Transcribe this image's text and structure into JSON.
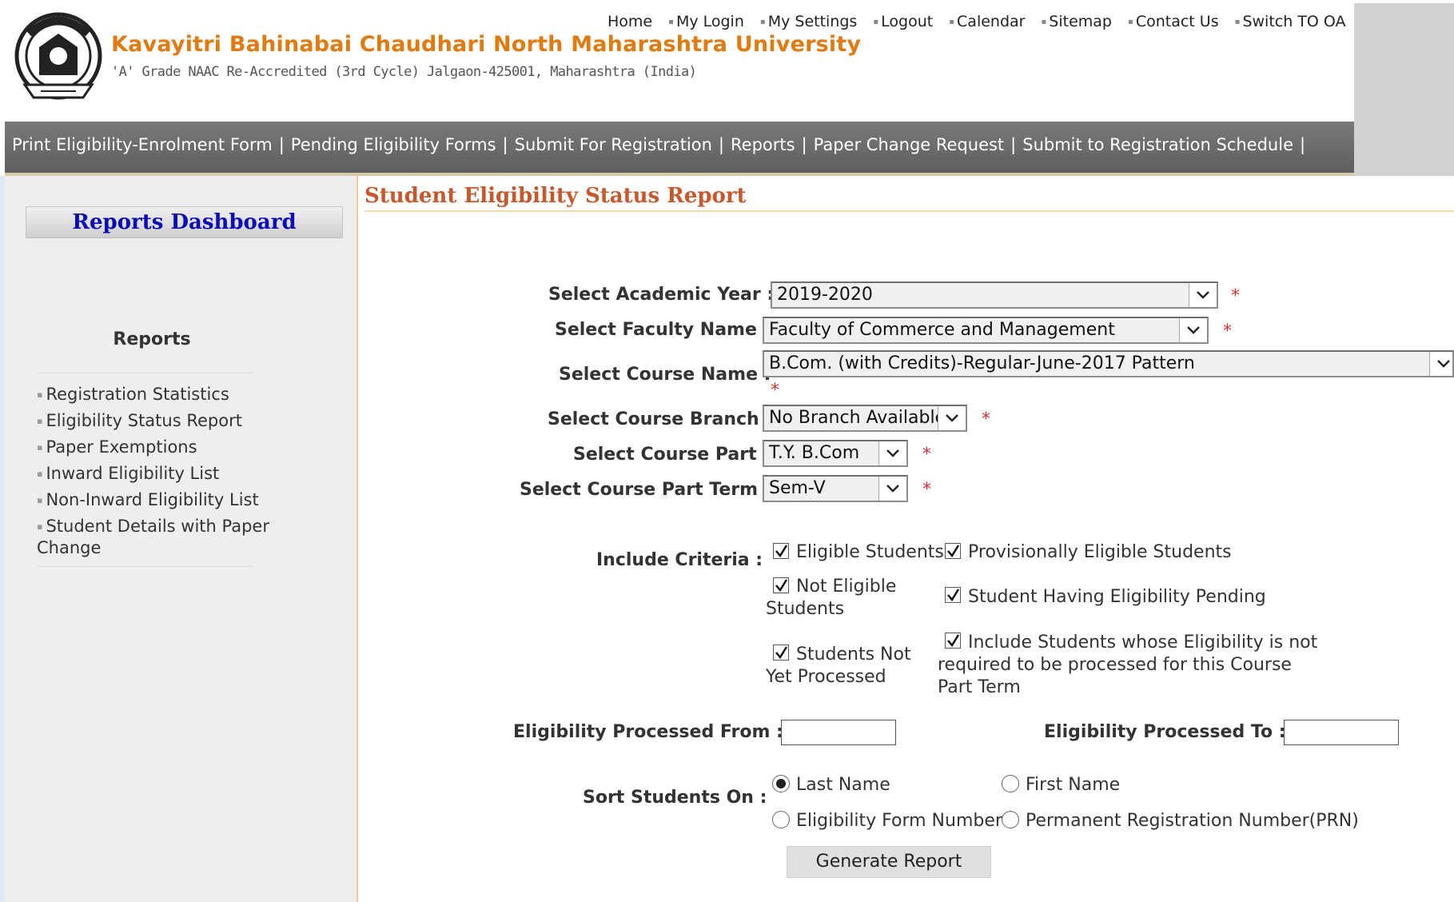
{
  "header": {
    "university_name": "Kavayitri Bahinabai Chaudhari North Maharashtra University",
    "university_sub": "'A' Grade NAAC Re-Accredited (3rd Cycle) Jalgaon-425001, Maharashtra (India)",
    "logo_icon": "university-seal-icon",
    "top_links": [
      "Home",
      "My Login",
      "My Settings",
      "Logout",
      "Calendar",
      "Sitemap",
      "Contact Us",
      "Switch TO OA"
    ]
  },
  "nav": {
    "items": [
      "Print Eligibility-Enrolment Form",
      "Pending Eligibility Forms",
      "Submit For Registration",
      "Reports",
      "Paper Change Request",
      "Submit to Registration Schedule"
    ]
  },
  "sidebar": {
    "title": "Reports Dashboard",
    "heading": "Reports",
    "items": [
      "Registration Statistics",
      "Eligibility Status Report",
      "Paper Exemptions",
      "Inward Eligibility List",
      "Non-Inward Eligibility List",
      "Student Details with Paper Change"
    ]
  },
  "main": {
    "title": "Student Eligibility Status Report",
    "fields": {
      "academic_year": {
        "label": "Select Academic Year  :",
        "value": "2019-2020"
      },
      "faculty": {
        "label": "Select Faculty Name :",
        "value": "Faculty of Commerce and Management"
      },
      "course": {
        "label": "Select Course Name :",
        "value": "B.Com. (with Credits)-Regular-June-2017 Pattern"
      },
      "branch": {
        "label": "Select Course Branch :",
        "value": "No Branch Available"
      },
      "part": {
        "label": "Select Course Part :",
        "value": "T.Y. B.Com"
      },
      "term": {
        "label": "Select Course Part Term :",
        "value": "Sem-V"
      }
    },
    "required_mark": "*",
    "criteria": {
      "label": "Include Criteria  :",
      "options": [
        {
          "label": "Eligible Students",
          "checked": true
        },
        {
          "label": "Provisionally Eligible Students",
          "checked": true
        },
        {
          "label": "Not Eligible Students",
          "checked": true
        },
        {
          "label": "Student Having Eligibility Pending",
          "checked": true
        },
        {
          "label": "Students Not Yet Processed",
          "checked": true
        },
        {
          "label": "Include Students whose Eligibility is not required to be processed for this Course Part Term",
          "checked": true
        }
      ]
    },
    "processed_from": {
      "label": "Eligibility Processed From  :",
      "value": ""
    },
    "processed_to": {
      "label": "Eligibility Processed To  :",
      "value": ""
    },
    "sort": {
      "label": "Sort Students On :",
      "options": [
        "Last Name",
        "First Name",
        "Eligibility Form Number",
        "Permanent Registration Number(PRN)"
      ],
      "selected": "Last Name"
    },
    "generate_button": "Generate Report"
  },
  "colors": {
    "university_name": "#e07b12",
    "nav_bg": "#6b6b6b",
    "dashboard_title": "#0a0ab8",
    "page_title": "#c9572c",
    "required": "#e03030",
    "sidebar_bg": "#eeeeee"
  }
}
